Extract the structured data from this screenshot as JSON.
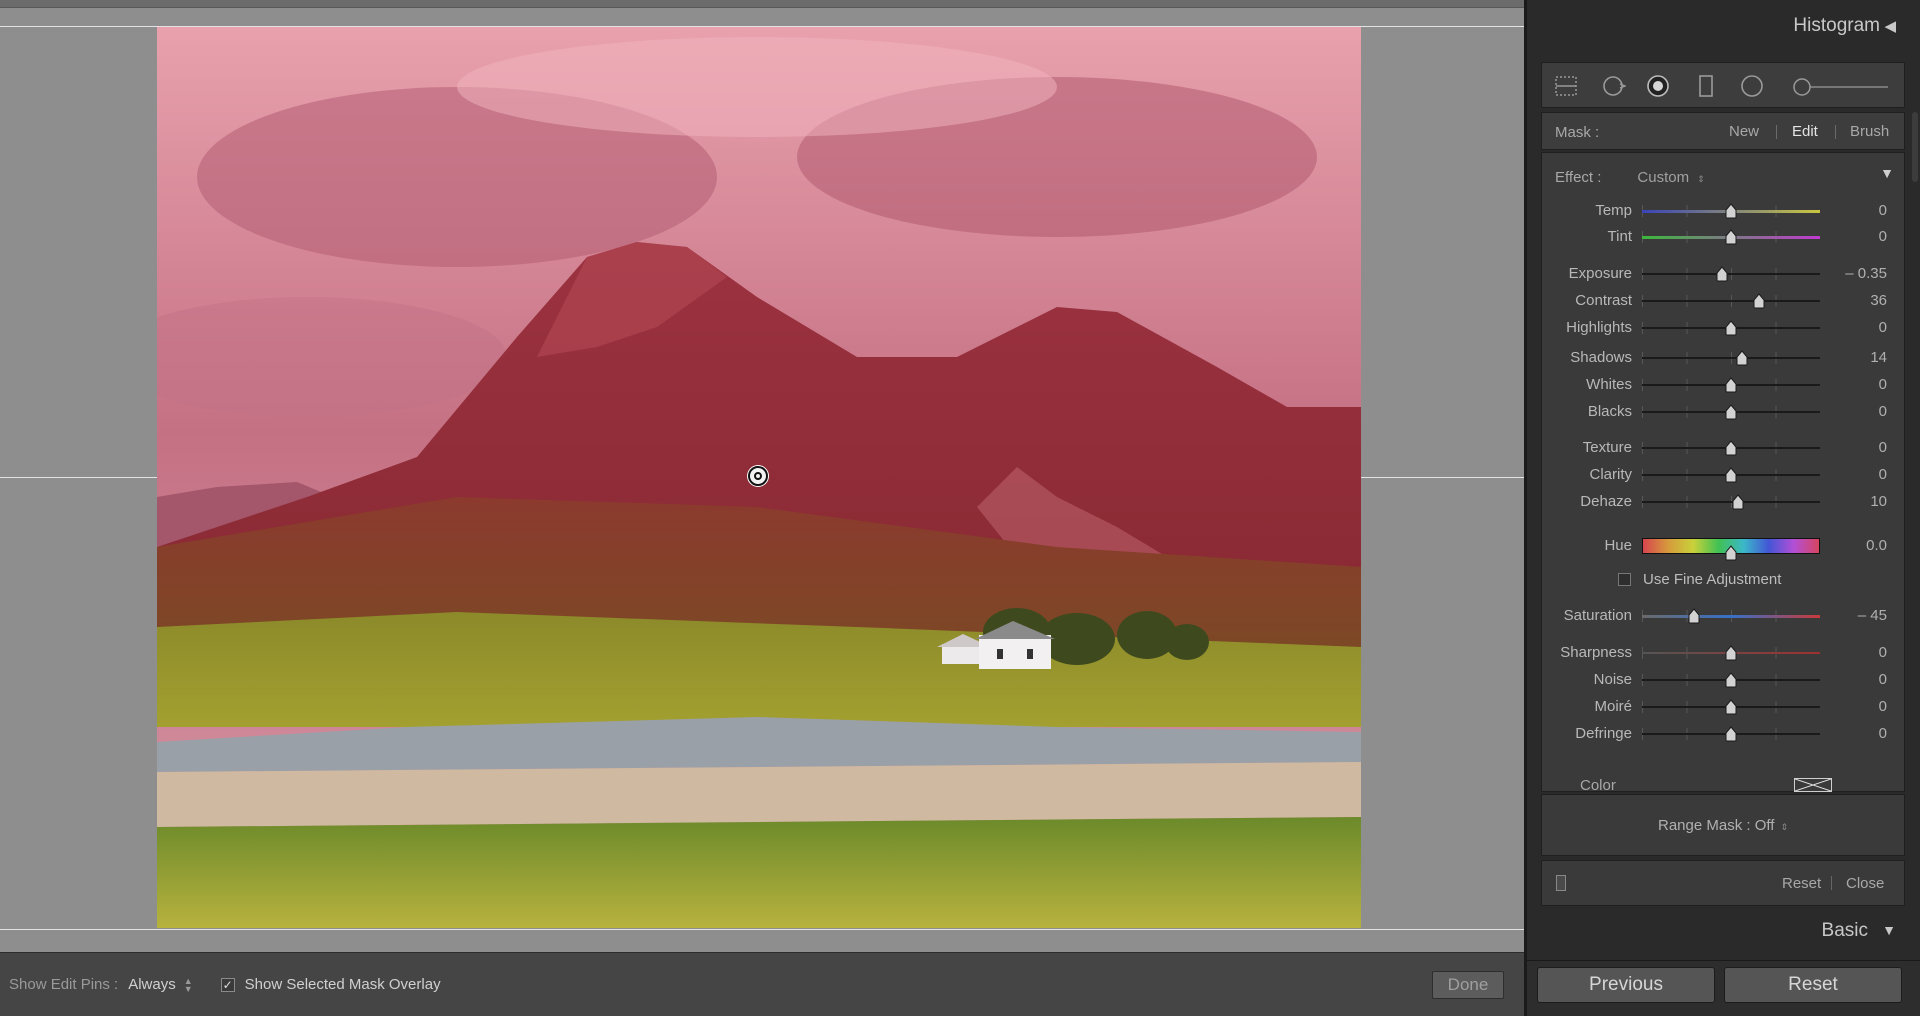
{
  "toolbar": {
    "show_edit_pins_label": "Show Edit Pins :",
    "show_edit_pins_value": "Always",
    "overlay_checked": "✓",
    "overlay_label": "Show Selected Mask Overlay",
    "done_label": "Done"
  },
  "panel": {
    "histogram_title": "Histogram",
    "mask": {
      "label": "Mask :",
      "new": "New",
      "edit": "Edit",
      "brush": "Brush"
    },
    "effect": {
      "label": "Effect :",
      "value": "Custom"
    },
    "sliders": [
      {
        "label": "Temp",
        "value": "0",
        "pos": 0.5
      },
      {
        "label": "Tint",
        "value": "0",
        "pos": 0.5
      },
      {
        "label": "Exposure",
        "value": "– 0.35",
        "pos": 0.45
      },
      {
        "label": "Contrast",
        "value": "36",
        "pos": 0.66
      },
      {
        "label": "Highlights",
        "value": "0",
        "pos": 0.5
      },
      {
        "label": "Shadows",
        "value": "14",
        "pos": 0.56
      },
      {
        "label": "Whites",
        "value": "0",
        "pos": 0.5
      },
      {
        "label": "Blacks",
        "value": "0",
        "pos": 0.5
      },
      {
        "label": "Texture",
        "value": "0",
        "pos": 0.5
      },
      {
        "label": "Clarity",
        "value": "0",
        "pos": 0.5
      },
      {
        "label": "Dehaze",
        "value": "10",
        "pos": 0.54
      },
      {
        "label": "Hue",
        "value": "0.0",
        "pos": 0.5
      },
      {
        "label": "Saturation",
        "value": "– 45",
        "pos": 0.29
      },
      {
        "label": "Sharpness",
        "value": "0",
        "pos": 0.5
      },
      {
        "label": "Noise",
        "value": "0",
        "pos": 0.5
      },
      {
        "label": "Moiré",
        "value": "0",
        "pos": 0.5
      },
      {
        "label": "Defringe",
        "value": "0",
        "pos": 0.5
      }
    ],
    "fine_adjustment_label": "Use Fine Adjustment",
    "color_label": "Color",
    "range_mask": "Range Mask : Off",
    "reset_label": "Reset",
    "close_label": "Close",
    "basic_title": "Basic",
    "previous_button": "Previous",
    "reset_button": "Reset"
  },
  "icons": {
    "graduated_filter": "graduated-filter-icon",
    "radial_filter": "radial-filter-icon",
    "spot_removal": "spot-removal-icon",
    "crop": "crop-icon",
    "red_eye": "red-eye-icon",
    "brush_size": "brush-size-slider"
  },
  "colors": {
    "mask_overlay": "#c8566e",
    "panel_bg": "#2a2a2a",
    "canvas_bg": "#8e8e8e"
  }
}
